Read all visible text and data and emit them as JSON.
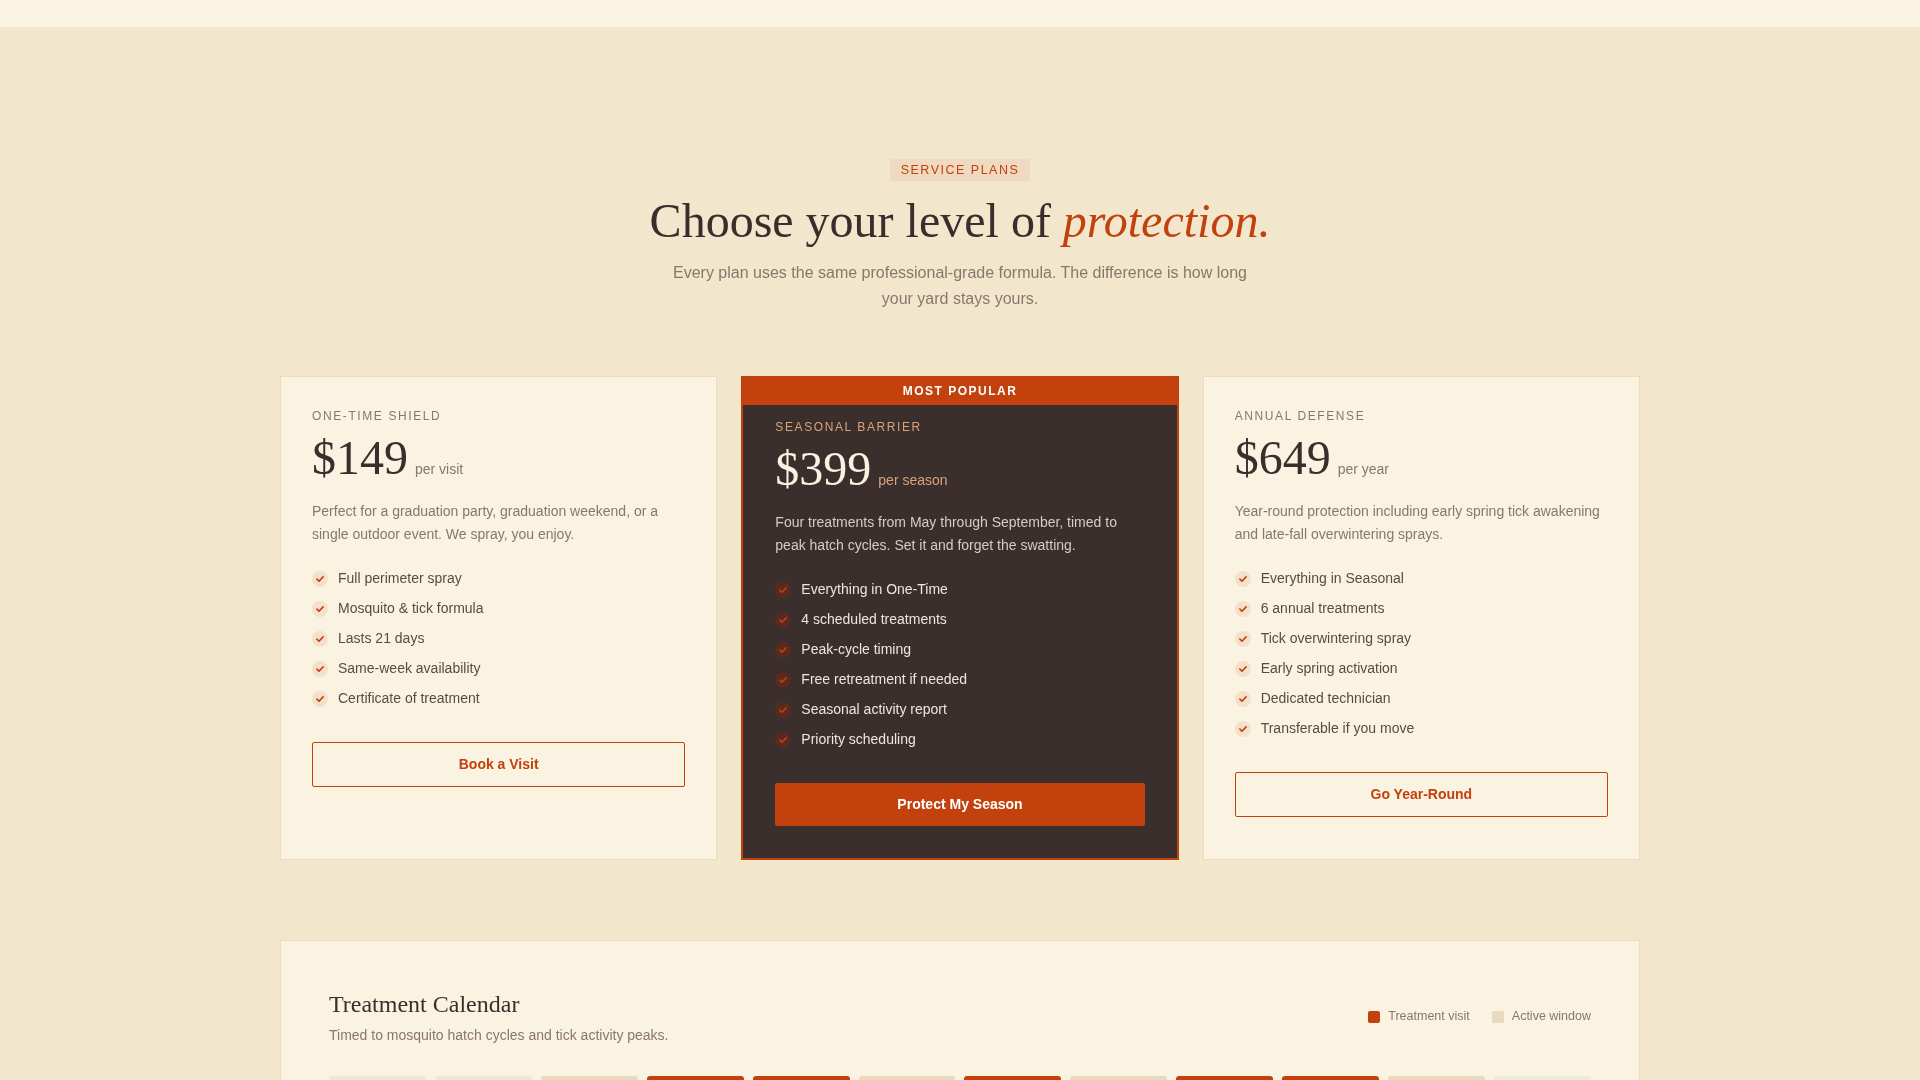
{
  "header": {
    "eyebrow": "SERVICE PLANS",
    "title": "Choose your level of *protection.*",
    "subtitle": "Every plan uses the same professional-grade formula. The difference is how long your yard stays yours."
  },
  "plans": [
    {
      "featured": false,
      "name": "ONE-TIME SHIELD",
      "price": "$149",
      "period": "per visit",
      "description": "Perfect for a graduation party, graduation weekend, or a single outdoor event. We spray, you enjoy.",
      "features": [
        "Full perimeter spray",
        "Mosquito & tick formula",
        "Lasts 21 days",
        "Same-week availability",
        "Certificate of treatment"
      ],
      "button": "Book a Visit"
    },
    {
      "featured": true,
      "badge": "MOST POPULAR",
      "name": "SEASONAL BARRIER",
      "price": "$399",
      "period": "per season",
      "description": "Four treatments from May through September, timed to peak hatch cycles. Set it and forget the swatting.",
      "features": [
        "Everything in One-Time",
        "4 scheduled treatments",
        "Peak-cycle timing",
        "Free retreatment if needed",
        "Seasonal activity report",
        "Priority scheduling"
      ],
      "button": "Protect My Season"
    },
    {
      "featured": false,
      "name": "ANNUAL DEFENSE",
      "price": "$649",
      "period": "per year",
      "description": "Year-round protection including early spring tick awakening and late-fall overwintering sprays.",
      "features": [
        "Everything in Seasonal",
        "6 annual treatments",
        "Tick overwintering spray",
        "Early spring activation",
        "Dedicated technician",
        "Transferable if you move"
      ],
      "button": "Go Year-Round"
    }
  ],
  "calendar": {
    "title": "Treatment Calendar",
    "subtitle": "Timed to mosquito hatch cycles and tick activity peaks.",
    "legend": [
      {
        "label": "Treatment visit",
        "color": "#c2410c"
      },
      {
        "label": "Active window",
        "color": "#ead8bf"
      }
    ],
    "months": [
      {
        "color": "#efe6d6"
      },
      {
        "color": "#efe6d6"
      },
      {
        "color": "#ead8bf"
      },
      {
        "color": "#c2410c"
      },
      {
        "color": "#c2410c"
      },
      {
        "color": "#ead8bf"
      },
      {
        "color": "#c2410c"
      },
      {
        "color": "#ead8bf"
      },
      {
        "color": "#c2410c"
      },
      {
        "color": "#c2410c"
      },
      {
        "color": "#ead8bf"
      },
      {
        "color": "#f0e9dd"
      }
    ]
  }
}
